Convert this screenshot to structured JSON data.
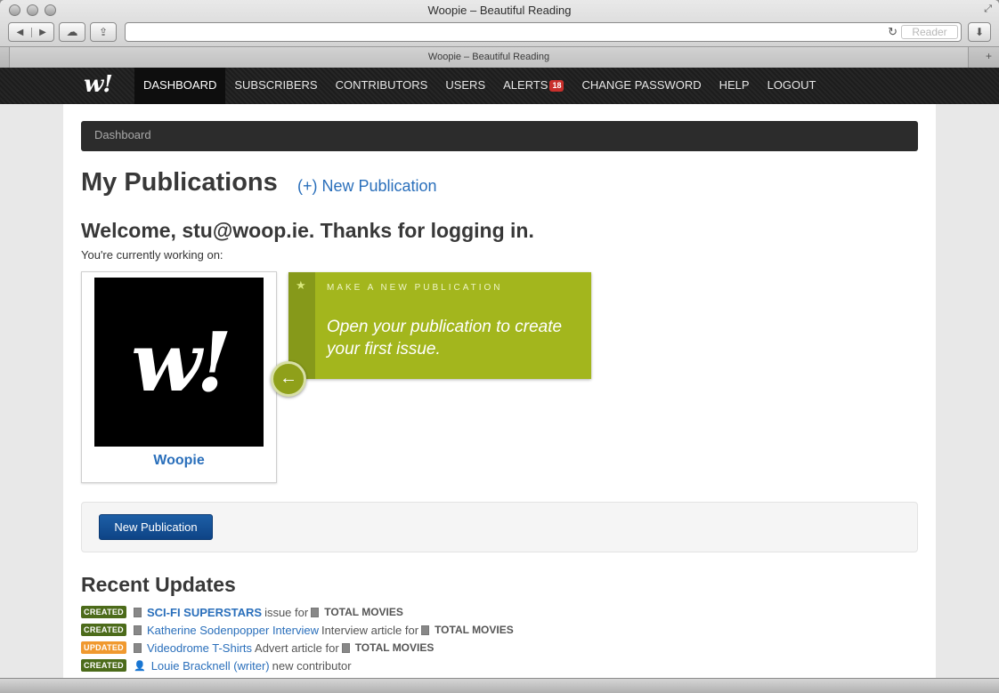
{
  "window": {
    "title": "Woopie – Beautiful Reading"
  },
  "toolbar": {
    "back_icon": "back-arrow-icon",
    "forward_icon": "forward-arrow-icon",
    "address_value": "",
    "reader_label": "Reader"
  },
  "tab": {
    "title": "Woopie – Beautiful Reading"
  },
  "nav": {
    "logo": "w!",
    "items": [
      {
        "label": "DASHBOARD",
        "active": true
      },
      {
        "label": "SUBSCRIBERS"
      },
      {
        "label": "CONTRIBUTORS"
      },
      {
        "label": "USERS"
      },
      {
        "label": "ALERTS",
        "badge": "18"
      },
      {
        "label": "CHANGE PASSWORD"
      },
      {
        "label": "HELP"
      },
      {
        "label": "LOGOUT"
      }
    ]
  },
  "breadcrumb": "Dashboard",
  "main": {
    "title": "My Publications",
    "new_publication_link": "(+) New Publication",
    "welcome": "Welcome, stu@woop.ie. Thanks for logging in.",
    "working_on": "You're currently working on:"
  },
  "publication": {
    "name": "Woopie",
    "image_text": "w!"
  },
  "tip": {
    "kicker": "MAKE A NEW PUBLICATION",
    "body": "Open your publication to create your first issue."
  },
  "actions": {
    "new_publication_button": "New Publication"
  },
  "recent": {
    "title": "Recent Updates",
    "items": [
      {
        "status": "CREATED",
        "kind": "created",
        "icon": "document-icon",
        "link": "SCI-FI SUPERSTARS",
        "link_bold": true,
        "text": "issue for",
        "pub": "TOTAL MOVIES"
      },
      {
        "status": "CREATED",
        "kind": "created",
        "icon": "document-icon",
        "link": "Katherine Sodenpopper Interview",
        "text": "Interview article for",
        "pub": "TOTAL MOVIES"
      },
      {
        "status": "UPDATED",
        "kind": "updated",
        "icon": "document-icon",
        "link": "Videodrome T-Shirts",
        "text": "Advert article for",
        "pub": "TOTAL MOVIES"
      },
      {
        "status": "CREATED",
        "kind": "created",
        "icon": "person-icon",
        "link": "Louie Bracknell (writer)",
        "text": "new contributor",
        "pub": ""
      }
    ]
  }
}
